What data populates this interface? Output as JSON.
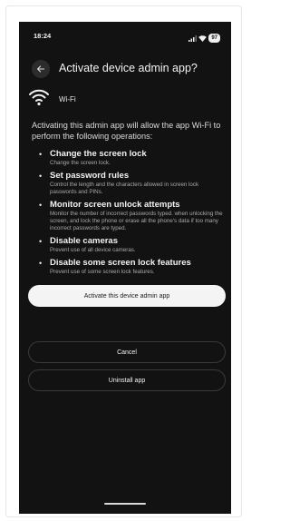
{
  "status_bar": {
    "time": "18:24",
    "battery": "97",
    "signal_icon": "signal-icon",
    "wifi_icon": "wifi-status-icon"
  },
  "header": {
    "title": "Activate device admin app?",
    "back_icon": "arrow-left-icon"
  },
  "app": {
    "name": "Wi-Fi",
    "icon": "wifi-icon"
  },
  "description": "Activating this admin app will allow the app Wi-Fi to perform the following operations:",
  "permissions": [
    {
      "title": "Change the screen lock",
      "desc": "Change the screen lock."
    },
    {
      "title": "Set password rules",
      "desc": "Control the length and the characters allowed in screen lock passwords and PINs."
    },
    {
      "title": "Monitor screen unlock attempts",
      "desc": "Monitor the number of incorrect passwords typed. when unlocking the screen, and lock the phone or erase all the phone's data if too many incorrect passwords are typed."
    },
    {
      "title": "Disable cameras",
      "desc": "Prevent use of all device cameras."
    },
    {
      "title": "Disable some screen lock features",
      "desc": "Prevent use of some screen lock features."
    }
  ],
  "buttons": {
    "activate": "Activate this device admin app",
    "cancel": "Cancel",
    "uninstall": "Uninstall app"
  },
  "colors": {
    "background": "#121212",
    "primary_button": "#f4f4f4",
    "text": "#e9e9e9",
    "muted_text": "#a9a9a9"
  }
}
